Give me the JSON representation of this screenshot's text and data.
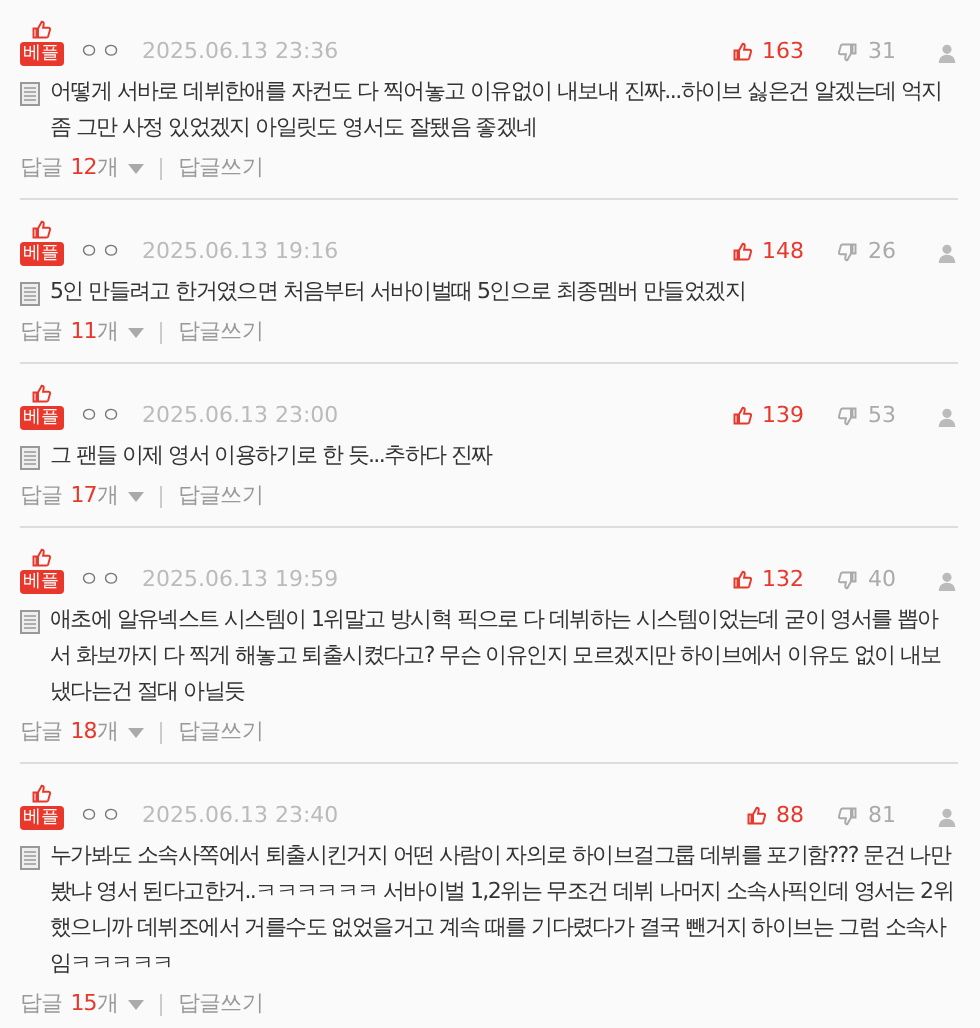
{
  "comments": [
    {
      "badge": "베플",
      "author": "ㅇㅇ",
      "date": "2025.06.13 23:36",
      "likes": "163",
      "dislikes": "31",
      "text": "어떻게 서바로 데뷔한애를 자컨도 다 찍어놓고 이유없이 내보내 진짜...하이브 싫은건 알겠는데 억지 좀 그만 사정 있었겠지 아일릿도 영서도 잘됐음 좋겠네",
      "reply_label": "답글",
      "reply_count": "12",
      "reply_unit": "개",
      "write_reply": "답글쓰기"
    },
    {
      "badge": "베플",
      "author": "ㅇㅇ",
      "date": "2025.06.13 19:16",
      "likes": "148",
      "dislikes": "26",
      "text": "5인 만들려고 한거였으면 처음부터 서바이벌때 5인으로 최종멤버 만들었겠지",
      "reply_label": "답글",
      "reply_count": "11",
      "reply_unit": "개",
      "write_reply": "답글쓰기"
    },
    {
      "badge": "베플",
      "author": "ㅇㅇ",
      "date": "2025.06.13 23:00",
      "likes": "139",
      "dislikes": "53",
      "text": "그 팬들 이제 영서 이용하기로 한 듯...추하다 진짜",
      "reply_label": "답글",
      "reply_count": "17",
      "reply_unit": "개",
      "write_reply": "답글쓰기"
    },
    {
      "badge": "베플",
      "author": "ㅇㅇ",
      "date": "2025.06.13 19:59",
      "likes": "132",
      "dislikes": "40",
      "text": "애초에 알유넥스트 시스템이 1위말고 방시혁 픽으로 다 데뷔하는 시스템이었는데 굳이 영서를 뽑아서 화보까지 다 찍게 해놓고 퇴출시켰다고? 무슨 이유인지 모르겠지만 하이브에서 이유도 없이 내보냈다는건 절대 아닐듯",
      "reply_label": "답글",
      "reply_count": "18",
      "reply_unit": "개",
      "write_reply": "답글쓰기"
    },
    {
      "badge": "베플",
      "author": "ㅇㅇ",
      "date": "2025.06.13 23:40",
      "likes": "88",
      "dislikes": "81",
      "text": "누가봐도 소속사쪽에서 퇴출시킨거지 어떤 사람이 자의로 하이브걸그룹 데뷔를 포기함??? 문건 나만봤냐 영서 된다고한거..ㅋㅋㅋㅋㅋㅋ 서바이벌 1,2위는 무조건 데뷔 나머지 소속사픽인데 영서는 2위했으니까 데뷔조에서 거를수도 없었을거고 계속 때를 기다렸다가 결국 뺀거지 하이브는 그럼 소속사임ㅋㅋㅋㅋㅋ",
      "reply_label": "답글",
      "reply_count": "15",
      "reply_unit": "개",
      "write_reply": "답글쓰기"
    }
  ]
}
